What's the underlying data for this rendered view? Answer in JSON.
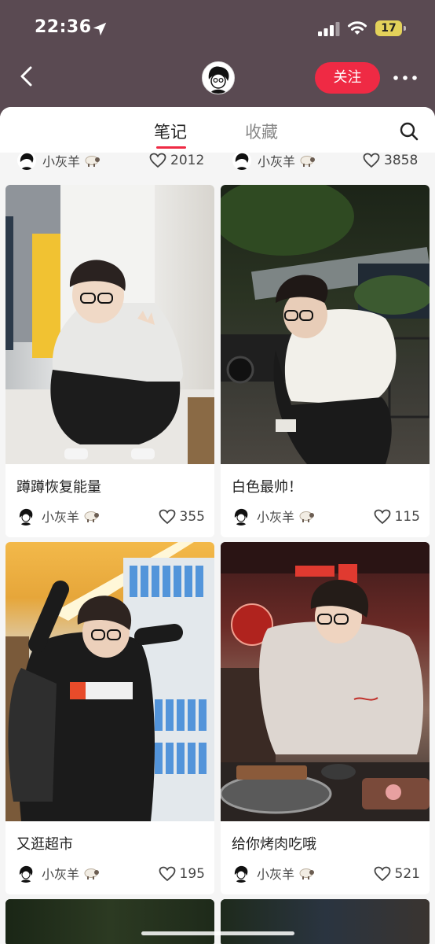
{
  "status_bar": {
    "time": "22:36",
    "battery": "17"
  },
  "nav": {
    "follow_label": "关注"
  },
  "tabs": [
    {
      "label": "笔记"
    },
    {
      "label": "收藏"
    }
  ],
  "partial_row": [
    {
      "author": "小灰羊",
      "likes": "2012"
    },
    {
      "author": "小灰羊",
      "likes": "3858"
    }
  ],
  "notes": [
    {
      "title": "蹲蹲恢复能量",
      "author": "小灰羊",
      "likes": "355"
    },
    {
      "title": "白色最帅！",
      "author": "小灰羊",
      "likes": "115"
    },
    {
      "title": "又逛超市",
      "author": "小灰羊",
      "likes": "195"
    },
    {
      "title": "给你烤肉吃哦",
      "author": "小灰羊",
      "likes": "521"
    }
  ],
  "colors": {
    "accent": "#ef2a44",
    "header_bg": "#5a4a52",
    "sheet_bg": "#f5f5f5"
  },
  "icons": [
    "location-arrow-icon",
    "signal-icon",
    "wifi-icon",
    "back-chevron-icon",
    "more-dots-icon",
    "search-icon",
    "heart-icon",
    "sheep-icon"
  ]
}
